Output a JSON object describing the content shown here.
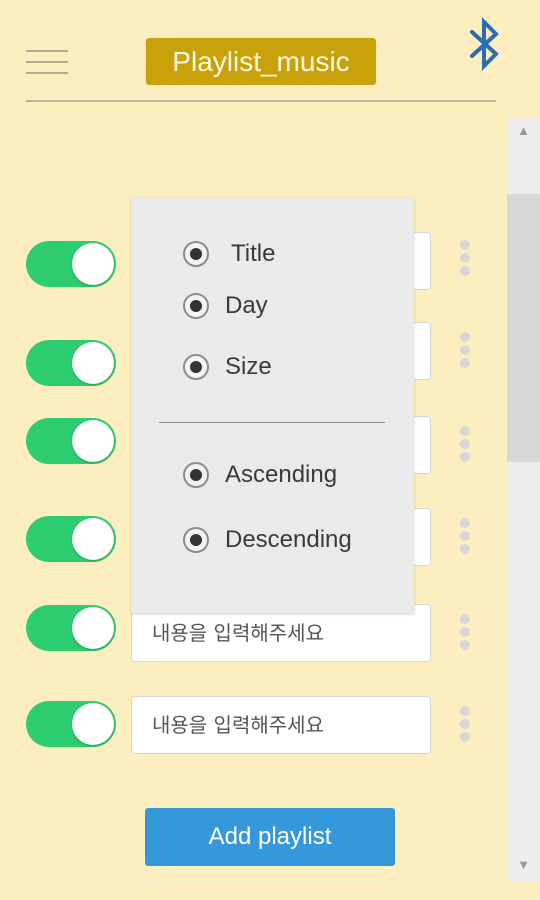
{
  "header": {
    "title": "Playlist_music",
    "menu_icon": "hamburger-menu-icon",
    "bluetooth_icon": "bluetooth-icon"
  },
  "playlist_rows": [
    {
      "toggle_on": true,
      "placeholder": ""
    },
    {
      "toggle_on": true,
      "placeholder": ""
    },
    {
      "toggle_on": true,
      "placeholder": ""
    },
    {
      "toggle_on": true,
      "placeholder": ""
    },
    {
      "toggle_on": true,
      "placeholder": "내용을 입력해주세요"
    },
    {
      "toggle_on": true,
      "placeholder": "내용을 입력해주세요"
    }
  ],
  "sort_popup": {
    "sort_by": [
      "Title",
      "Day",
      "Size"
    ],
    "order": [
      "Ascending",
      "Descending"
    ]
  },
  "footer": {
    "add_button_label": "Add playlist"
  },
  "colors": {
    "background": "#fdeebf",
    "title_badge": "#c9a20b",
    "toggle_on": "#2ecc71",
    "add_button": "#3498db",
    "bluetooth": "#2b6db3"
  }
}
